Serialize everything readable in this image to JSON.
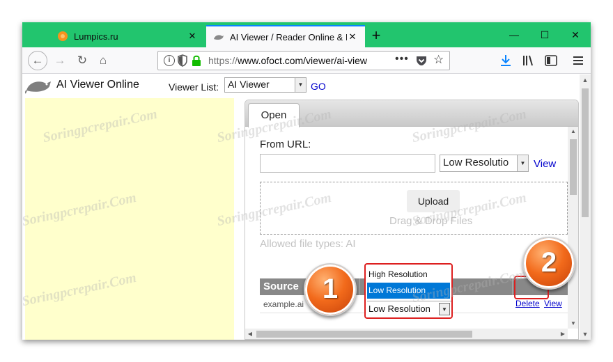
{
  "browser": {
    "tabs": [
      {
        "label": "Lumpics.ru",
        "icon": "orange-circle-favicon",
        "active": false
      },
      {
        "label": "AI Viewer / Reader Online & Fre",
        "icon": "rodent-favicon",
        "active": true
      }
    ],
    "url_protocol": "https://",
    "url_rest": "www.ofoct.com/viewer/ai-view",
    "more_label": "•••",
    "newtab_label": "+",
    "close_tab_label": "✕"
  },
  "site": {
    "title": "AI Viewer Online",
    "viewer_list_label": "Viewer List:",
    "viewer_list_value": "AI Viewer",
    "go_label": "GO"
  },
  "tool": {
    "tab_open_label": "Open",
    "from_url_label": "From URL:",
    "resolution_value": "Low Resolutio",
    "view_label": "View",
    "upload_label": "Upload",
    "drop_text": "Drag & Drop Files",
    "allowed_types": "Allowed file types: AI",
    "table_header_source": "Source",
    "row": {
      "filename": "example.ai",
      "delete_label": "Delete",
      "view_label": "View"
    }
  },
  "dropdown": {
    "options": [
      "High Resolution",
      "Low Resolution"
    ],
    "selected": "Low Resolution",
    "current_value": "Low Resolution"
  },
  "annotations": {
    "step1": "1",
    "step2": "2"
  },
  "watermark_text": "Soringpcrepair.Com",
  "colors": {
    "tabstrip": "#22c56e",
    "highlight": "#dd1f1f",
    "selection": "#0078d7",
    "link": "#0000cc",
    "marker": "#f26a1b"
  }
}
